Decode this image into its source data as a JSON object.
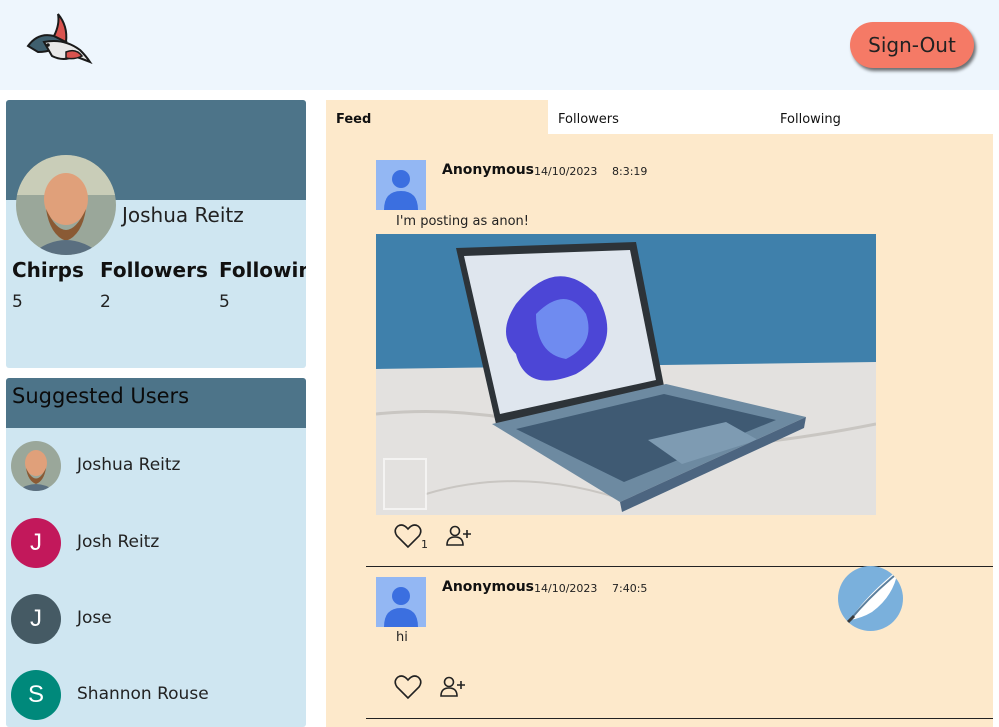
{
  "header": {
    "logo_icon": "swallow-bird-logo-icon",
    "signout_label": "Sign-Out"
  },
  "profile": {
    "name": "Joshua Reitz",
    "stats": [
      {
        "label": "Chirps",
        "value": "5"
      },
      {
        "label": "Followers",
        "value": "2"
      },
      {
        "label": "Following",
        "value": "5"
      }
    ]
  },
  "suggested": {
    "title": "Suggested Users",
    "users": [
      {
        "name": "Joshua Reitz",
        "initial": "",
        "color": "#8a9aa5"
      },
      {
        "name": "Josh Reitz",
        "initial": "J",
        "color": "#c2185b"
      },
      {
        "name": "Jose",
        "initial": "J",
        "color": "#455a64"
      },
      {
        "name": "Shannon Rouse",
        "initial": "S",
        "color": "#00897b"
      }
    ]
  },
  "tabs": [
    {
      "label": "Feed",
      "active": true
    },
    {
      "label": "Followers",
      "active": false
    },
    {
      "label": "Following",
      "active": false
    }
  ],
  "posts": [
    {
      "author": "Anonymous",
      "date": "14/10/2023",
      "time": "8:3:19",
      "text": "I'm posting as anon!",
      "has_image": true,
      "likes": "1"
    },
    {
      "author": "Anonymous",
      "date": "14/10/2023",
      "time": "7:40:5",
      "text": "hi",
      "has_image": false,
      "likes": ""
    }
  ],
  "fab": {
    "icon": "feather-compose-icon"
  },
  "colors": {
    "header_bg": "#eef6fd",
    "card_bg": "#cfe6f1",
    "card_header": "#4d7489",
    "feed_bg": "#fde9cb",
    "signout": "#f57a66",
    "avatar_placeholder": "#93b7f3"
  }
}
